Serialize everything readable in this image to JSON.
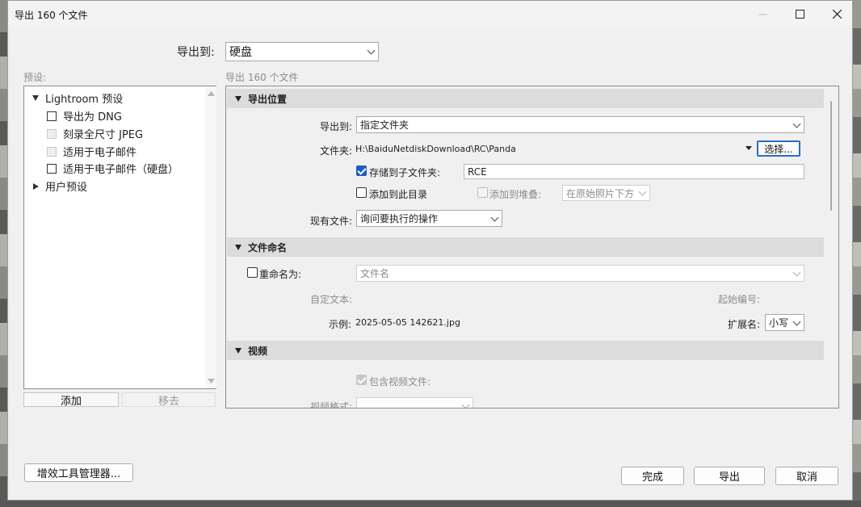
{
  "window": {
    "title": "导出 160 个文件"
  },
  "export_to": {
    "label": "导出到:",
    "value": "硬盘"
  },
  "presets": {
    "label": "预设:",
    "lightroom_group": "Lightroom 预设",
    "items": [
      "导出为 DNG",
      "刻录全尺寸 JPEG",
      "适用于电子邮件",
      "适用于电子邮件（硬盘）"
    ],
    "user_group": "用户预设",
    "add_label": "添加",
    "remove_label": "移去"
  },
  "main": {
    "summary": "导出 160 个文件",
    "location": {
      "header": "导出位置",
      "export_to_label": "导出到:",
      "export_to_value": "指定文件夹",
      "folder_label": "文件夹:",
      "folder_path": "H:\\BaiduNetdiskDownload\\RC\\Panda",
      "choose_label": "选择...",
      "subfolder_label": "存储到子文件夹:",
      "subfolder_value": "RCE",
      "add_catalog_label": "添加到此目录",
      "add_stack_label": "添加到堆叠:",
      "stack_position": "在原始照片下方",
      "existing_label": "现有文件:",
      "existing_value": "询问要执行的操作"
    },
    "naming": {
      "header": "文件命名",
      "rename_label": "重命名为:",
      "rename_value": "文件名",
      "custom_text_label": "自定文本:",
      "start_number_label": "起始编号:",
      "example_label": "示例:",
      "example_value": "2025-05-05 142621.jpg",
      "extension_label": "扩展名:",
      "extension_value": "小写"
    },
    "video": {
      "header": "视频",
      "include_label": "包含视频文件:",
      "format_label": "视频格式:"
    }
  },
  "footer": {
    "plugin_manager": "增效工具管理器...",
    "done": "完成",
    "export": "导出",
    "cancel": "取消"
  }
}
